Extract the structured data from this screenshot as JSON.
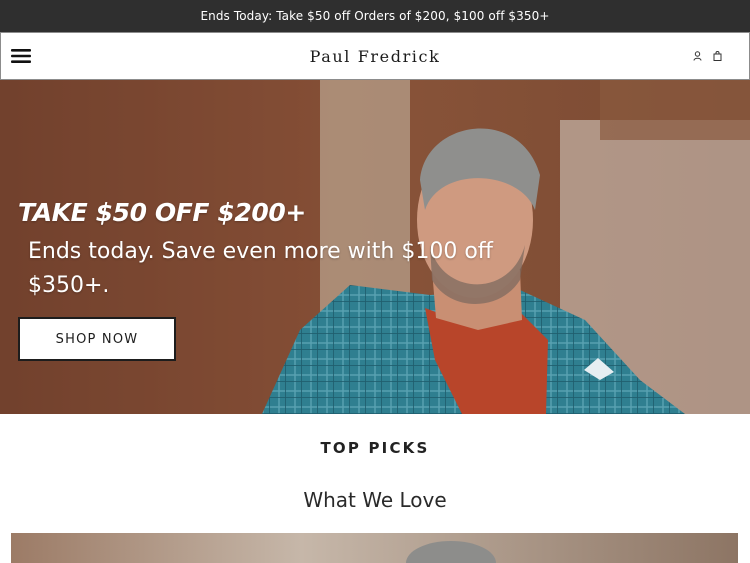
{
  "promo_bar": {
    "text": "Ends Today: Take $50 off Orders of $200, $100 off $350+"
  },
  "header": {
    "logo": "Paul Fredrick",
    "menu_icon": "hamburger-menu-icon",
    "account_icon": "user-icon",
    "bag_icon": "shopping-bag-icon"
  },
  "hero": {
    "headline": "TAKE $50 OFF $200+",
    "subtext": "Ends today. Save even more with $100 off $350+.",
    "cta_label": "SHOP NOW"
  },
  "section": {
    "eyebrow": "TOP PICKS",
    "title": "What We Love"
  },
  "colors": {
    "promo_bar_bg": "#2f2f2f",
    "jacket_teal": "#2e7f8f",
    "sweater_orange": "#b8452a",
    "brick_brown": "#7b4a33"
  }
}
